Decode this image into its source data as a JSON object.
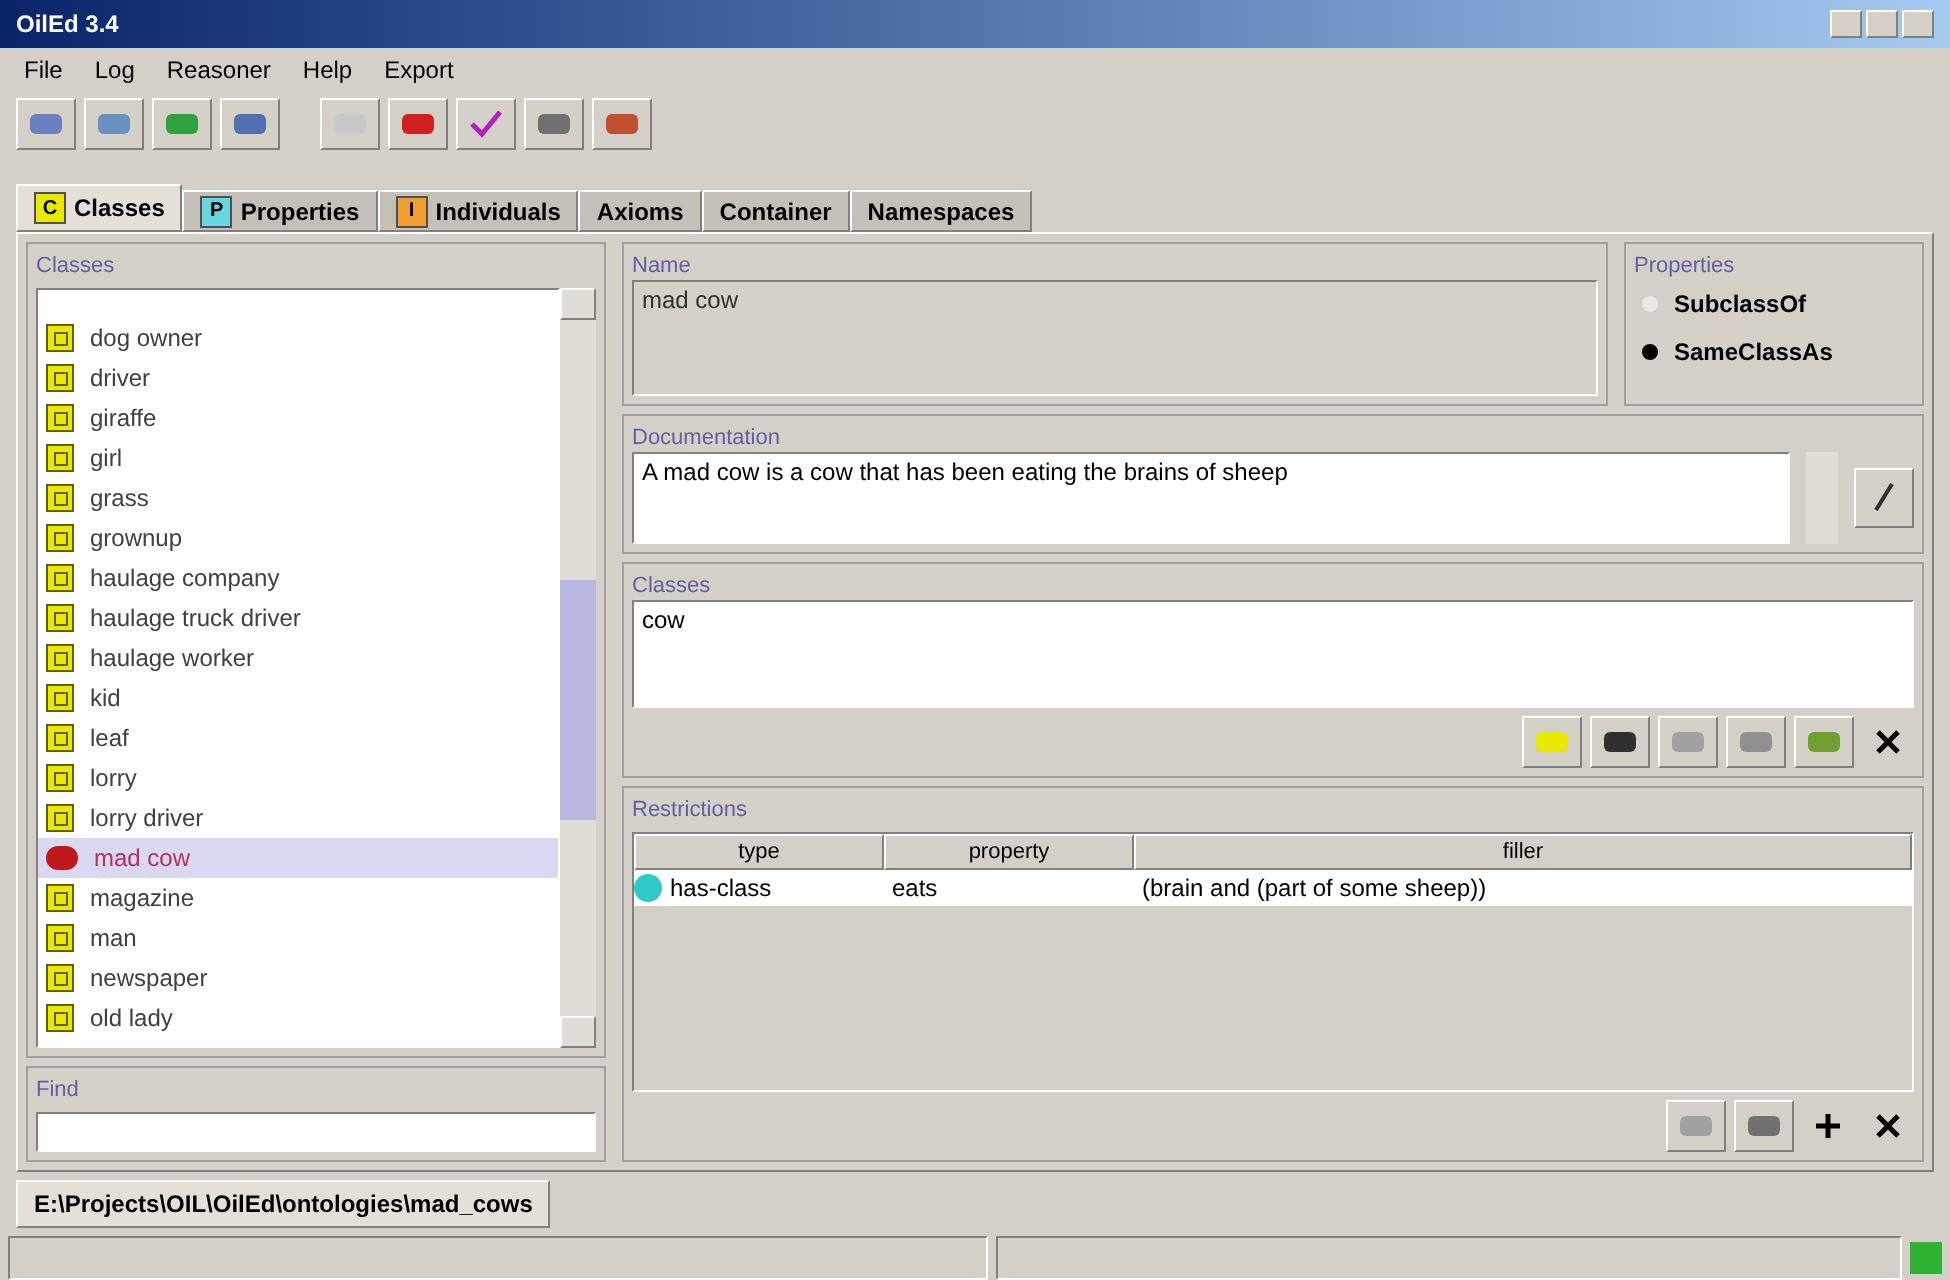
{
  "window": {
    "title": "OilEd 3.4"
  },
  "menu": [
    "File",
    "Log",
    "Reasoner",
    "Help",
    "Export"
  ],
  "tabs": [
    {
      "label": "Classes",
      "icon": "C",
      "color": "#e8e800",
      "selected": true
    },
    {
      "label": "Properties",
      "icon": "P",
      "color": "#66d6e0",
      "selected": false
    },
    {
      "label": "Individuals",
      "icon": "I",
      "color": "#f0a030",
      "selected": false
    },
    {
      "label": "Axioms",
      "selected": false
    },
    {
      "label": "Container",
      "selected": false
    },
    {
      "label": "Namespaces",
      "selected": false
    }
  ],
  "classes_panel": {
    "title": "Classes",
    "items": [
      {
        "label": "dog owner",
        "kind": "primitive",
        "selected": false
      },
      {
        "label": "driver",
        "kind": "primitive",
        "selected": false
      },
      {
        "label": "giraffe",
        "kind": "primitive",
        "selected": false
      },
      {
        "label": "girl",
        "kind": "primitive",
        "selected": false
      },
      {
        "label": "grass",
        "kind": "primitive",
        "selected": false
      },
      {
        "label": "grownup",
        "kind": "primitive",
        "selected": false
      },
      {
        "label": "haulage company",
        "kind": "primitive",
        "selected": false
      },
      {
        "label": "haulage truck driver",
        "kind": "primitive",
        "selected": false
      },
      {
        "label": "haulage worker",
        "kind": "primitive",
        "selected": false
      },
      {
        "label": "kid",
        "kind": "primitive",
        "selected": false
      },
      {
        "label": "leaf",
        "kind": "primitive",
        "selected": false
      },
      {
        "label": "lorry",
        "kind": "primitive",
        "selected": false
      },
      {
        "label": "lorry driver",
        "kind": "primitive",
        "selected": false
      },
      {
        "label": "mad cow",
        "kind": "defined",
        "selected": true
      },
      {
        "label": "magazine",
        "kind": "primitive",
        "selected": false
      },
      {
        "label": "man",
        "kind": "primitive",
        "selected": false
      },
      {
        "label": "newspaper",
        "kind": "primitive",
        "selected": false
      },
      {
        "label": "old lady",
        "kind": "primitive",
        "selected": false
      }
    ],
    "find_label": "Find"
  },
  "name": {
    "title": "Name",
    "value": "mad cow"
  },
  "properties": {
    "title": "Properties",
    "options": [
      {
        "label": "SubclassOf",
        "selected": false
      },
      {
        "label": "SameClassAs",
        "selected": true
      }
    ]
  },
  "documentation": {
    "title": "Documentation",
    "value": "A mad cow is a cow that has been eating the brains of sheep"
  },
  "superclasses": {
    "title": "Classes",
    "value": "cow"
  },
  "restrictions": {
    "title": "Restrictions",
    "columns": [
      "type",
      "property",
      "filler"
    ],
    "rows": [
      {
        "type": "has-class",
        "property": "eats",
        "filler": "(brain and (part of some sheep))"
      }
    ]
  },
  "file_tab": "E:\\Projects\\OIL\\OilEd\\ontologies\\mad_cows"
}
